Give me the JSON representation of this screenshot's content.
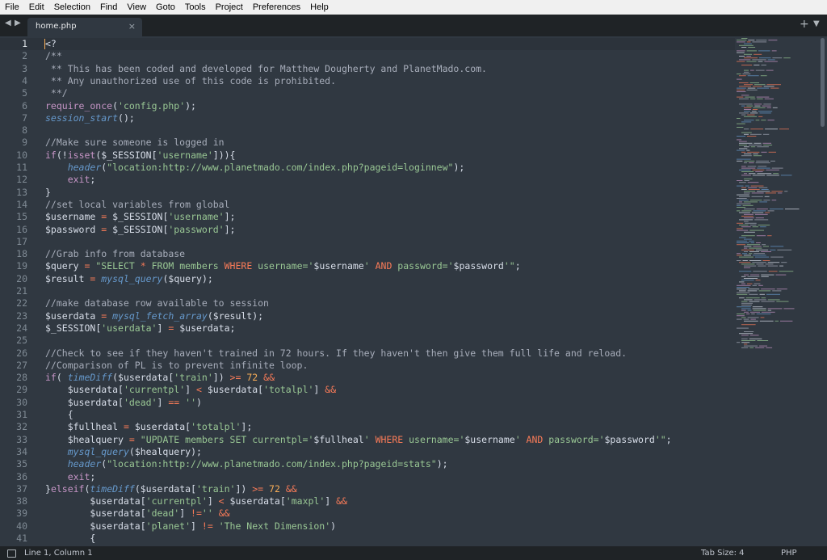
{
  "menu": [
    "File",
    "Edit",
    "Selection",
    "Find",
    "View",
    "Goto",
    "Tools",
    "Project",
    "Preferences",
    "Help"
  ],
  "tab": {
    "name": "home.php",
    "close": "×"
  },
  "toolbar_icons": [
    "plus-icon",
    "chevron-down-icon"
  ],
  "status": {
    "position": "Line 1, Column 1",
    "tab_size": "Tab Size: 4",
    "syntax": "PHP"
  },
  "colors": {
    "editor_bg": "#303841",
    "comment": "#a7adba",
    "keyword": "#c695c6",
    "string": "#99c794",
    "function": "#6699cc",
    "operator": "#f97b58",
    "number": "#f9ae58"
  },
  "code_lines": [
    [
      [
        "pl",
        "<?"
      ]
    ],
    [
      [
        "cm",
        "/**"
      ]
    ],
    [
      [
        "cm",
        " ** This has been coded and developed for Matthew Dougherty and PlanetMado.com."
      ]
    ],
    [
      [
        "cm",
        " ** Any unauthorized use of this code is prohibited."
      ]
    ],
    [
      [
        "cm",
        " **/"
      ]
    ],
    [
      [
        "kw",
        "require_once"
      ],
      [
        "pl",
        "("
      ],
      [
        "st",
        "'config.php'"
      ],
      [
        "pl",
        ");"
      ]
    ],
    [
      [
        "fn",
        "session_start"
      ],
      [
        "pl",
        "();"
      ]
    ],
    [
      [
        "pl",
        ""
      ]
    ],
    [
      [
        "cm",
        "//Make sure someone is logged in"
      ]
    ],
    [
      [
        "kw",
        "if"
      ],
      [
        "pl",
        "(!"
      ],
      [
        "kw",
        "isset"
      ],
      [
        "pl",
        "("
      ],
      [
        "vr",
        "$_SESSION"
      ],
      [
        "pl",
        "["
      ],
      [
        "st",
        "'username'"
      ],
      [
        "pl",
        "])){"
      ]
    ],
    [
      [
        "pl",
        "    "
      ],
      [
        "fn",
        "header"
      ],
      [
        "pl",
        "("
      ],
      [
        "st",
        "\"location:http://www.planetmado.com/index.php?pageid=loginnew\""
      ],
      [
        "pl",
        ");"
      ]
    ],
    [
      [
        "pl",
        "    "
      ],
      [
        "kw",
        "exit"
      ],
      [
        "pl",
        ";"
      ]
    ],
    [
      [
        "pl",
        "}"
      ]
    ],
    [
      [
        "cm",
        "//set local variables from global"
      ]
    ],
    [
      [
        "vr",
        "$username"
      ],
      [
        "pl",
        " "
      ],
      [
        "op",
        "="
      ],
      [
        "pl",
        " "
      ],
      [
        "vr",
        "$_SESSION"
      ],
      [
        "pl",
        "["
      ],
      [
        "st",
        "'username'"
      ],
      [
        "pl",
        "];"
      ]
    ],
    [
      [
        "vr",
        "$password"
      ],
      [
        "pl",
        " "
      ],
      [
        "op",
        "="
      ],
      [
        "pl",
        " "
      ],
      [
        "vr",
        "$_SESSION"
      ],
      [
        "pl",
        "["
      ],
      [
        "st",
        "'password'"
      ],
      [
        "pl",
        "];"
      ]
    ],
    [
      [
        "pl",
        ""
      ]
    ],
    [
      [
        "cm",
        "//Grab info from database"
      ]
    ],
    [
      [
        "vr",
        "$query"
      ],
      [
        "pl",
        " "
      ],
      [
        "op",
        "="
      ],
      [
        "pl",
        " "
      ],
      [
        "st",
        "\"SELECT "
      ],
      [
        "op",
        "*"
      ],
      [
        "st",
        " FROM members "
      ],
      [
        "op",
        "WHERE"
      ],
      [
        "st",
        " username='"
      ],
      [
        "vr",
        "$username"
      ],
      [
        "st",
        "' "
      ],
      [
        "op",
        "AND"
      ],
      [
        "st",
        " password='"
      ],
      [
        "vr",
        "$password"
      ],
      [
        "st",
        "'\""
      ],
      [
        "pl",
        ";"
      ]
    ],
    [
      [
        "vr",
        "$result"
      ],
      [
        "pl",
        " "
      ],
      [
        "op",
        "="
      ],
      [
        "pl",
        " "
      ],
      [
        "fn",
        "mysql_query"
      ],
      [
        "pl",
        "("
      ],
      [
        "vr",
        "$query"
      ],
      [
        "pl",
        ");"
      ]
    ],
    [
      [
        "pl",
        ""
      ]
    ],
    [
      [
        "cm",
        "//make database row available to session"
      ]
    ],
    [
      [
        "vr",
        "$userdata"
      ],
      [
        "pl",
        " "
      ],
      [
        "op",
        "="
      ],
      [
        "pl",
        " "
      ],
      [
        "fn",
        "mysql_fetch_array"
      ],
      [
        "pl",
        "("
      ],
      [
        "vr",
        "$result"
      ],
      [
        "pl",
        ");"
      ]
    ],
    [
      [
        "vr",
        "$_SESSION"
      ],
      [
        "pl",
        "["
      ],
      [
        "st",
        "'userdata'"
      ],
      [
        "pl",
        "] "
      ],
      [
        "op",
        "="
      ],
      [
        "pl",
        " "
      ],
      [
        "vr",
        "$userdata"
      ],
      [
        "pl",
        ";"
      ]
    ],
    [
      [
        "pl",
        ""
      ]
    ],
    [
      [
        "cm",
        "//Check to see if they haven't trained in 72 hours. If they haven't then give them full life and reload."
      ]
    ],
    [
      [
        "cm",
        "//Comparison of PL is to prevent infinite loop."
      ]
    ],
    [
      [
        "kw",
        "if"
      ],
      [
        "pl",
        "( "
      ],
      [
        "fn",
        "timeDiff"
      ],
      [
        "pl",
        "("
      ],
      [
        "vr",
        "$userdata"
      ],
      [
        "pl",
        "["
      ],
      [
        "st",
        "'train'"
      ],
      [
        "pl",
        "]) "
      ],
      [
        "op",
        ">="
      ],
      [
        "pl",
        " "
      ],
      [
        "nm",
        "72"
      ],
      [
        "pl",
        " "
      ],
      [
        "op",
        "&&"
      ]
    ],
    [
      [
        "pl",
        "    "
      ],
      [
        "vr",
        "$userdata"
      ],
      [
        "pl",
        "["
      ],
      [
        "st",
        "'currentpl'"
      ],
      [
        "pl",
        "] "
      ],
      [
        "op",
        "<"
      ],
      [
        "pl",
        " "
      ],
      [
        "vr",
        "$userdata"
      ],
      [
        "pl",
        "["
      ],
      [
        "st",
        "'totalpl'"
      ],
      [
        "pl",
        "] "
      ],
      [
        "op",
        "&&"
      ]
    ],
    [
      [
        "pl",
        "    "
      ],
      [
        "vr",
        "$userdata"
      ],
      [
        "pl",
        "["
      ],
      [
        "st",
        "'dead'"
      ],
      [
        "pl",
        "] "
      ],
      [
        "op",
        "=="
      ],
      [
        "pl",
        " "
      ],
      [
        "st",
        "''"
      ],
      [
        "pl",
        ")"
      ]
    ],
    [
      [
        "pl",
        "    {"
      ]
    ],
    [
      [
        "pl",
        "    "
      ],
      [
        "vr",
        "$fullheal"
      ],
      [
        "pl",
        " "
      ],
      [
        "op",
        "="
      ],
      [
        "pl",
        " "
      ],
      [
        "vr",
        "$userdata"
      ],
      [
        "pl",
        "["
      ],
      [
        "st",
        "'totalpl'"
      ],
      [
        "pl",
        "];"
      ]
    ],
    [
      [
        "pl",
        "    "
      ],
      [
        "vr",
        "$healquery"
      ],
      [
        "pl",
        " "
      ],
      [
        "op",
        "="
      ],
      [
        "pl",
        " "
      ],
      [
        "st",
        "\"UPDATE members SET currentpl='"
      ],
      [
        "vr",
        "$fullheal"
      ],
      [
        "st",
        "' "
      ],
      [
        "op",
        "WHERE"
      ],
      [
        "st",
        " username='"
      ],
      [
        "vr",
        "$username"
      ],
      [
        "st",
        "' "
      ],
      [
        "op",
        "AND"
      ],
      [
        "st",
        " password='"
      ],
      [
        "vr",
        "$password"
      ],
      [
        "st",
        "'\""
      ],
      [
        "pl",
        ";"
      ]
    ],
    [
      [
        "pl",
        "    "
      ],
      [
        "fn",
        "mysql_query"
      ],
      [
        "pl",
        "("
      ],
      [
        "vr",
        "$healquery"
      ],
      [
        "pl",
        ");"
      ]
    ],
    [
      [
        "pl",
        "    "
      ],
      [
        "fn",
        "header"
      ],
      [
        "pl",
        "("
      ],
      [
        "st",
        "\"location:http://www.planetmado.com/index.php?pageid=stats\""
      ],
      [
        "pl",
        ");"
      ]
    ],
    [
      [
        "pl",
        "    "
      ],
      [
        "kw",
        "exit"
      ],
      [
        "pl",
        ";"
      ]
    ],
    [
      [
        "pl",
        "}"
      ],
      [
        "kw",
        "elseif"
      ],
      [
        "pl",
        "("
      ],
      [
        "fn",
        "timeDiff"
      ],
      [
        "pl",
        "("
      ],
      [
        "vr",
        "$userdata"
      ],
      [
        "pl",
        "["
      ],
      [
        "st",
        "'train'"
      ],
      [
        "pl",
        "]) "
      ],
      [
        "op",
        ">="
      ],
      [
        "pl",
        " "
      ],
      [
        "nm",
        "72"
      ],
      [
        "pl",
        " "
      ],
      [
        "op",
        "&&"
      ]
    ],
    [
      [
        "pl",
        "        "
      ],
      [
        "vr",
        "$userdata"
      ],
      [
        "pl",
        "["
      ],
      [
        "st",
        "'currentpl'"
      ],
      [
        "pl",
        "] "
      ],
      [
        "op",
        "<"
      ],
      [
        "pl",
        " "
      ],
      [
        "vr",
        "$userdata"
      ],
      [
        "pl",
        "["
      ],
      [
        "st",
        "'maxpl'"
      ],
      [
        "pl",
        "] "
      ],
      [
        "op",
        "&&"
      ]
    ],
    [
      [
        "pl",
        "        "
      ],
      [
        "vr",
        "$userdata"
      ],
      [
        "pl",
        "["
      ],
      [
        "st",
        "'dead'"
      ],
      [
        "pl",
        "] "
      ],
      [
        "op",
        "!="
      ],
      [
        "st",
        "''"
      ],
      [
        "pl",
        " "
      ],
      [
        "op",
        "&&"
      ]
    ],
    [
      [
        "pl",
        "        "
      ],
      [
        "vr",
        "$userdata"
      ],
      [
        "pl",
        "["
      ],
      [
        "st",
        "'planet'"
      ],
      [
        "pl",
        "] "
      ],
      [
        "op",
        "!="
      ],
      [
        "pl",
        " "
      ],
      [
        "st",
        "'The Next Dimension'"
      ],
      [
        "pl",
        ")"
      ]
    ],
    [
      [
        "pl",
        "        {"
      ]
    ]
  ]
}
